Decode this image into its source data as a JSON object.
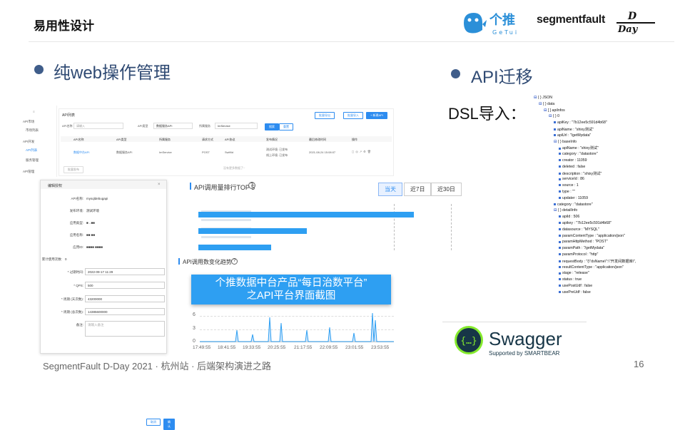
{
  "header": {
    "title": "易用性设计",
    "sf_logo": "segmentfault",
    "getui_cn": "个推",
    "getui_en": "GeTui",
    "dday": "D-Day"
  },
  "left": {
    "heading": "纯web操作管理"
  },
  "right": {
    "heading": "API迁移",
    "dsl": "DSL导入："
  },
  "sidebar": {
    "items": [
      "API市场",
      "市场列表",
      "API开发",
      "API列表",
      "服务管理",
      "API管理"
    ]
  },
  "list": {
    "title": "API列表",
    "api_name_label": "API名称",
    "api_name_placeholder": "请输入",
    "type_label": "API类型",
    "type_value": "数据服务API",
    "env_label": "所属服务",
    "env_value": "ImService",
    "search_btn": "搜索",
    "reset_btn": "重置",
    "top_buttons": [
      "批量导出",
      "批量导入",
      "+ 新建API"
    ],
    "columns": [
      "API名称",
      "API类型",
      "所属服务",
      "请求方式",
      "API协议",
      "发布情况",
      "最后修改时间",
      "操作"
    ],
    "row": {
      "name": "数据中台API",
      "type": "数据服务API",
      "service": "ImService",
      "method": "POST",
      "protocol": "SwiftId",
      "status1": "测试环境: 已发布",
      "status2": "线上环境: 已发布",
      "time": "2021-08-24 15:08:07"
    },
    "batch_btn": "批量发布",
    "empty": "没有更多数据了~"
  },
  "modal": {
    "title": "编辑授权",
    "fields": [
      {
        "label": "API名称:",
        "value": "mysqldebugapi"
      },
      {
        "label": "发布环境:",
        "value": "测试环境"
      },
      {
        "label": "应用类型:",
        "value": "■ ..■■"
      },
      {
        "label": "应用名称:",
        "value": "■■ ■■"
      },
      {
        "label": "应用ID:",
        "value": "■■■■  ■■■■"
      },
      {
        "label": "累计使用次数:",
        "value": "0"
      }
    ],
    "expire_label": "* 过期时间:",
    "expire_value": "2022-09-17 11:29",
    "qps_label": "* QPS:",
    "qps_value": "500",
    "period_label": "* 周期 (天次数):",
    "period_value": "43200000",
    "total_label": "* 周期 (总次数):",
    "total_value": "14385600000",
    "note_label": "备注:",
    "note_placeholder": "请输入备注",
    "cancel": "取消",
    "confirm": "确认"
  },
  "chart_top": {
    "title": "API调用量排行TOP 5",
    "tabs": [
      "当天",
      "近7日",
      "近30日"
    ],
    "active": "当天"
  },
  "chart_trend": {
    "title": "API调用数变化趋势",
    "y_ticks": [
      "6",
      "3",
      "0"
    ],
    "x_ticks": [
      "17:49:55",
      "18:41:55",
      "19:33:55",
      "20:25:55",
      "21:17:55",
      "22:09:55",
      "23:01:55",
      "23:53:55"
    ]
  },
  "banner": {
    "line1": "个推数据中台产品“每日治数平台”",
    "line2": "之API平台界面截图"
  },
  "tree": [
    {
      "t": "{ } JSON",
      "d": 0,
      "k": "b"
    },
    {
      "t": "{ } data",
      "d": 1,
      "k": "b"
    },
    {
      "t": "[ ] apiInfos",
      "d": 2,
      "k": "b"
    },
    {
      "t": "{ } 0",
      "d": 3,
      "k": "b"
    },
    {
      "t": "apiKey : \"7b12ee5c591d4b68\"",
      "d": 4,
      "k": "s"
    },
    {
      "t": "apiName : \"shixy测试\"",
      "d": 4,
      "k": "s"
    },
    {
      "t": "apiUrl : \"/getMydata\"",
      "d": 4,
      "k": "s"
    },
    {
      "t": "{ } baseInfo",
      "d": 4,
      "k": "b"
    },
    {
      "t": "apiName : \"shixy测试\"",
      "d": 5,
      "k": "s"
    },
    {
      "t": "category : \"datastore\"",
      "d": 5,
      "k": "s"
    },
    {
      "t": "creator : 11059",
      "d": 5,
      "k": "s"
    },
    {
      "t": "deleted : false",
      "d": 5,
      "k": "s"
    },
    {
      "t": "description : \"shixy测试\"",
      "d": 5,
      "k": "s"
    },
    {
      "t": "serviceId : 86",
      "d": 5,
      "k": "s"
    },
    {
      "t": "source : 1",
      "d": 5,
      "k": "s"
    },
    {
      "t": "type : \"\"",
      "d": 5,
      "k": "s"
    },
    {
      "t": "updater : 11059",
      "d": 5,
      "k": "s"
    },
    {
      "t": "category : \"datastore\"",
      "d": 4,
      "k": "s"
    },
    {
      "t": "{ } detailInfo",
      "d": 4,
      "k": "b"
    },
    {
      "t": "apiId : 506",
      "d": 5,
      "k": "s"
    },
    {
      "t": "apikey : \"7b12ee5c591d4b68\"",
      "d": 5,
      "k": "s"
    },
    {
      "t": "datasource : \"MYSQL\"",
      "d": 5,
      "k": "s"
    },
    {
      "t": "paramContentType : \"application/json\"",
      "d": 5,
      "k": "s"
    },
    {
      "t": "paramHttpMethod : \"POST\"",
      "d": 5,
      "k": "s"
    },
    {
      "t": "paramPath : \"/getMydata\"",
      "d": 5,
      "k": "s"
    },
    {
      "t": "paramProtocol : \"http\"",
      "d": 5,
      "k": "s"
    },
    {
      "t": "requestBody : \"{\\\"dsName\\\":\\\"开发间数据库\\\",",
      "d": 5,
      "k": "s"
    },
    {
      "t": "resultContentType : \"application/json\"",
      "d": 5,
      "k": "s"
    },
    {
      "t": "stage : \"release\"",
      "d": 5,
      "k": "s"
    },
    {
      "t": "status : true",
      "d": 5,
      "k": "s"
    },
    {
      "t": "usePostUdf : false",
      "d": 5,
      "k": "s"
    },
    {
      "t": "usePreUdf : false",
      "d": 5,
      "k": "s"
    }
  ],
  "swagger": {
    "name": "Swagger",
    "sub": "Supported by SMARTBEAR"
  },
  "footer": {
    "text": "SegmentFault D-Day 2021 · 杭州站 · 后端架构演进之路",
    "page": "16"
  },
  "colors": {
    "accent": "#2f4a73",
    "bullet": "#3f5d8a",
    "primary": "#2d8cf0",
    "banner": "#2e9ff2",
    "swagger": "#85ea2d"
  }
}
